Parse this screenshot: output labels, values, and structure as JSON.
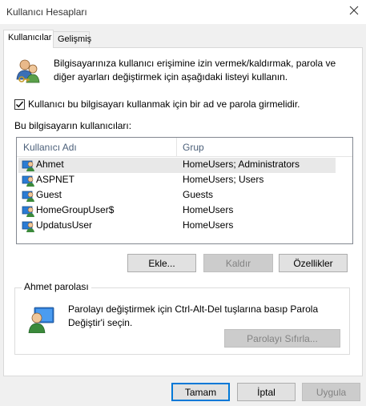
{
  "window": {
    "title": "Kullanıcı Hesapları"
  },
  "tabs": [
    {
      "label": "Kullanıcılar",
      "active": true
    },
    {
      "label": "Gelişmiş",
      "active": false
    }
  ],
  "intro": {
    "text": "Bilgisayarınıza kullanıcı erişimine izin vermek/kaldırmak, parola ve diğer ayarları değiştirmek için aşağıdaki listeyi kullanın.",
    "icon": "users-keys-icon"
  },
  "require_login": {
    "label": "Kullanıcı bu bilgisayarı kullanmak için bir ad ve parola girmelidir.",
    "checked": true
  },
  "users_list": {
    "caption": "Bu bilgisayarın kullanıcıları:",
    "columns": [
      "Kullanıcı Adı",
      "Grup"
    ],
    "rows": [
      {
        "name": "Ahmet",
        "group": "HomeUsers; Administrators",
        "selected": true
      },
      {
        "name": "ASPNET",
        "group": "HomeUsers; Users",
        "selected": false
      },
      {
        "name": "Guest",
        "group": "Guests",
        "selected": false
      },
      {
        "name": "HomeGroupUser$",
        "group": "HomeUsers",
        "selected": false
      },
      {
        "name": "UpdatusUser",
        "group": "HomeUsers",
        "selected": false
      }
    ]
  },
  "list_buttons": {
    "add": "Ekle...",
    "remove": "Kaldır",
    "properties": "Özellikler"
  },
  "password_group": {
    "title": "Ahmet parolası",
    "text": "Parolayı değiştirmek için Ctrl-Alt-Del tuşlarına basıp Parola Değiştir'i seçin.",
    "reset_button": "Parolayı Sıfırla..."
  },
  "dialog_buttons": {
    "ok": "Tamam",
    "cancel": "İptal",
    "apply": "Uygula"
  },
  "colors": {
    "accent": "#0078d7",
    "selection": "#e8e8e8",
    "header_text": "#4c607a"
  }
}
